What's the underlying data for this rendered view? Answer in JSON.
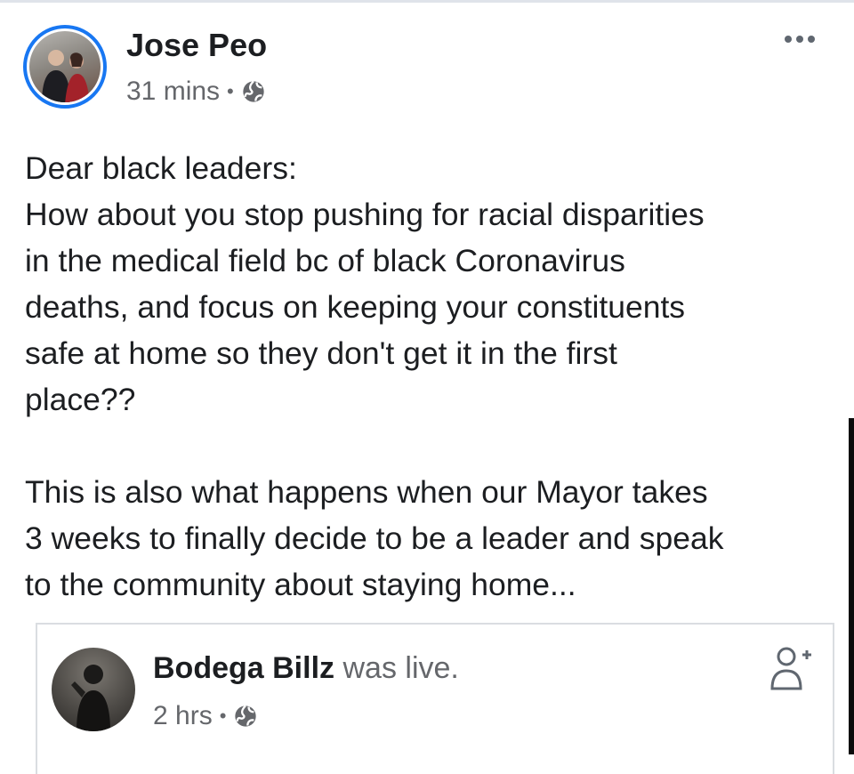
{
  "post": {
    "author": "Jose Peo",
    "time": "31 mins",
    "separator": "•",
    "privacy_icon": "globe-icon",
    "more_icon": "more-options-icon",
    "lines": [
      "Dear black leaders:",
      "How about you stop pushing for racial disparities",
      "in the medical field bc of black Coronavirus",
      "deaths, and focus on keeping your constituents",
      "safe at home so they don't get it in the first",
      "place??"
    ],
    "lines2": [
      "This is also what happens when our Mayor takes",
      "3 weeks to finally decide to be a leader and speak",
      "to the community about staying home..."
    ]
  },
  "shared": {
    "author": "Bodega Billz",
    "action": "was live.",
    "time": "2 hrs",
    "separator": "•",
    "privacy_icon": "globe-icon",
    "follow_icon": "add-friend-icon"
  },
  "colors": {
    "accent": "#1877f2",
    "text": "#1c1e21",
    "muted": "#65676b",
    "border": "#dadde1"
  }
}
